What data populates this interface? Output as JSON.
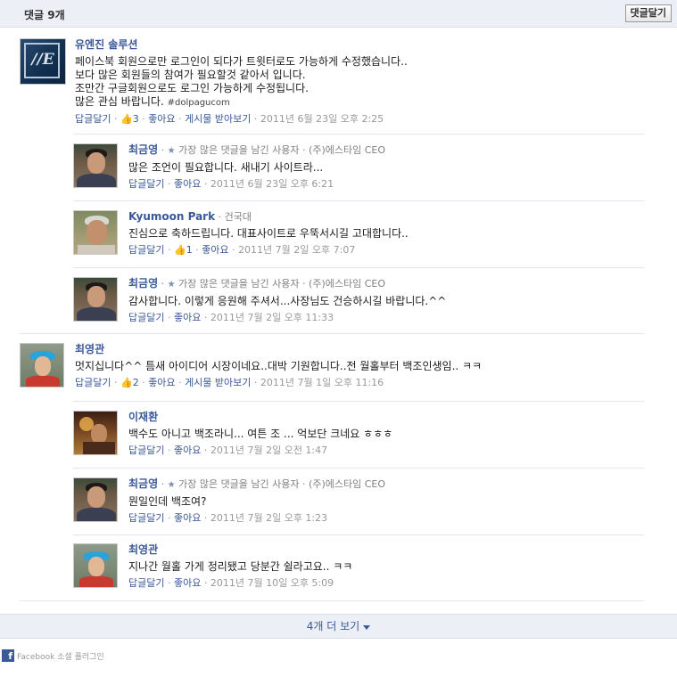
{
  "header": {
    "title": "댓글 9개",
    "post_button": "댓글달기"
  },
  "actions": {
    "reply": "답글달기",
    "like": "좋아요",
    "subscribe": "게시물 받아보기"
  },
  "top_commenter_badge": "가장 많은 댓글을 남긴 사용자",
  "comments": [
    {
      "author": "유엔진 솔루션",
      "lines": [
        "페이스북 회원으로만 로그인이 되다가 트윗터로도 가능하게 수정했습니다..",
        "보다 많은 회원들의 참여가 필요할것 같아서 입니다.",
        "조만간 구글회원으로도 로그인 가능하게 수정됩니다.",
        "많은 관심 바랍니다. "
      ],
      "hashtag": "#dolpagucom",
      "likes": "3",
      "time": "2011년 6월 23일 오후 2:25",
      "replies": [
        {
          "author": "최금영",
          "affiliation": "(주)에스타임 CEO",
          "text": "많은 조언이 필요합니다. 새내기 사이트라...",
          "time": "2011년 6월 23일 오후 6:21"
        },
        {
          "author": "Kyumoon Park",
          "affiliation": "건국대",
          "text": "진심으로 축하드립니다. 대표사이트로 우뚝서시길 고대합니다..",
          "likes": "1",
          "time": "2011년 7월 2일 오후 7:07"
        },
        {
          "author": "최금영",
          "affiliation": "(주)에스타임 CEO",
          "text": "감사합니다. 이렇게 응원해 주셔서...사장님도 건승하시길 바랍니다.^^",
          "time": "2011년 7월 2일 오후 11:33"
        }
      ]
    },
    {
      "author": "최영관",
      "lines": [
        "멋지십니다^^ 틈새 아이디어 시장이네요..대박 기원합니다..전 월홀부터 백조인생임.. ㅋㅋ"
      ],
      "likes": "2",
      "time": "2011년 7월 1일 오후 11:16",
      "replies": [
        {
          "author": "이재환",
          "text": "백수도 아니고 백조라니... 여튼 조 ... 억보단 크네요 ㅎㅎㅎ",
          "time": "2011년 7월 2일 오전 1:47"
        },
        {
          "author": "최금영",
          "affiliation": "(주)에스타임 CEO",
          "text": "뭔일인데 백조여?",
          "time": "2011년 7월 2일 오후 1:23"
        },
        {
          "author": "최영관",
          "text": "지나간 월홀 가게 정리됐고 당분간 쉴라고요.. ㅋㅋ",
          "time": "2011년 7월 10일 오후 5:09"
        }
      ]
    }
  ],
  "more": {
    "label": "4개 더 보기"
  },
  "footer": {
    "text": "Facebook 소셜 플러그인"
  },
  "colors": {
    "link": "#3b5998",
    "header_bg": "#eceff5",
    "meta": "#808080"
  }
}
